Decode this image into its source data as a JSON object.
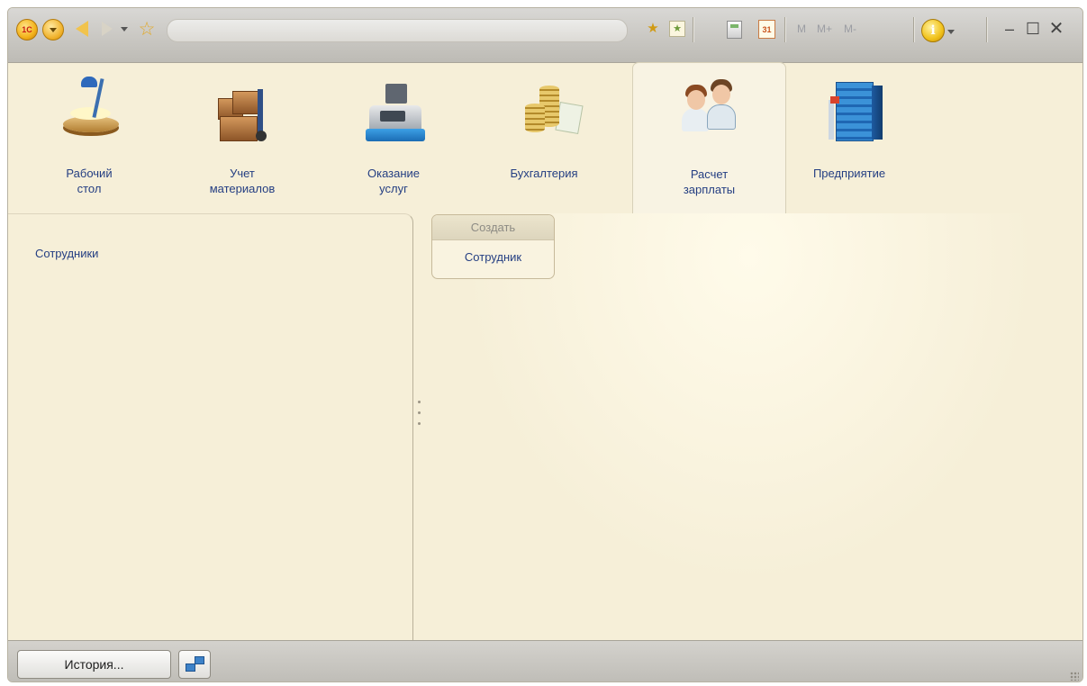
{
  "titlebar": {
    "memory_buttons": [
      "M",
      "M+",
      "M-"
    ],
    "calendar_day": "31"
  },
  "sections": [
    {
      "label": "Рабочий\nстол",
      "icon": "desktop-lamp-icon"
    },
    {
      "label": "Учет\nматериалов",
      "icon": "boxes-cart-icon"
    },
    {
      "label": "Оказание\nуслуг",
      "icon": "cash-register-icon"
    },
    {
      "label": "Бухгалтерия",
      "icon": "coins-icon"
    },
    {
      "label": "Расчет\nзарплаты",
      "icon": "employees-icon",
      "active": true
    },
    {
      "label": "Предприятие",
      "icon": "building-icon"
    }
  ],
  "navigation": {
    "items": [
      "Сотрудники"
    ]
  },
  "actions": {
    "title": "Создать",
    "items": [
      "Сотрудник"
    ]
  },
  "statusbar": {
    "history_label": "История..."
  },
  "colors": {
    "background": "#f6efd8",
    "link": "#243e82",
    "toolbar": "#c8c6c1"
  }
}
